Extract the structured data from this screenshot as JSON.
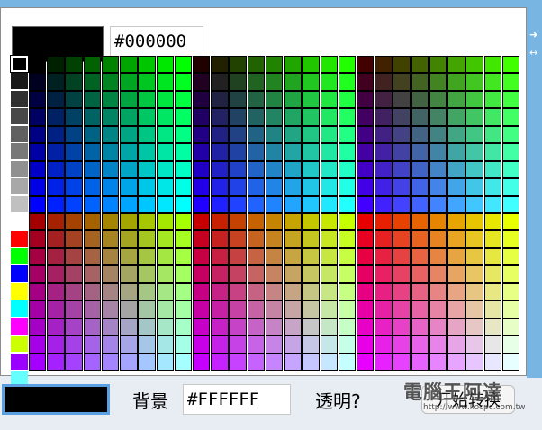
{
  "colors": {
    "window_blue": "#78b5e3",
    "selection_blue": "#5a9fe0"
  },
  "picker": {
    "current_color": "#000000",
    "hex_value": "#000000",
    "grayscale_strip": [
      "#000000",
      "#181818",
      "#303030",
      "#484848",
      "#606060",
      "#787878",
      "#909090",
      "#a8a8a8",
      "#c0c0c0",
      "#ffffff"
    ],
    "primary_strip": [
      "#ff0000",
      "#00ff00",
      "#0000ff",
      "#ffff00",
      "#00ffff",
      "#ff00ff",
      "#ccff00",
      "#9900ff",
      "#66ffff"
    ],
    "selected_strip_index": 0
  },
  "footer": {
    "swatch_color": "#000000",
    "background_label": "背景",
    "background_value": "#FFFFFF",
    "transparent_label": "透明?",
    "start_button": "开始转换"
  },
  "watermark": {
    "text": "電腦王阿達",
    "url": "http://www.kocpc.com.tw"
  },
  "icons": {
    "rail_top": "arrow-icon",
    "rail_second": "arrow-icon"
  }
}
